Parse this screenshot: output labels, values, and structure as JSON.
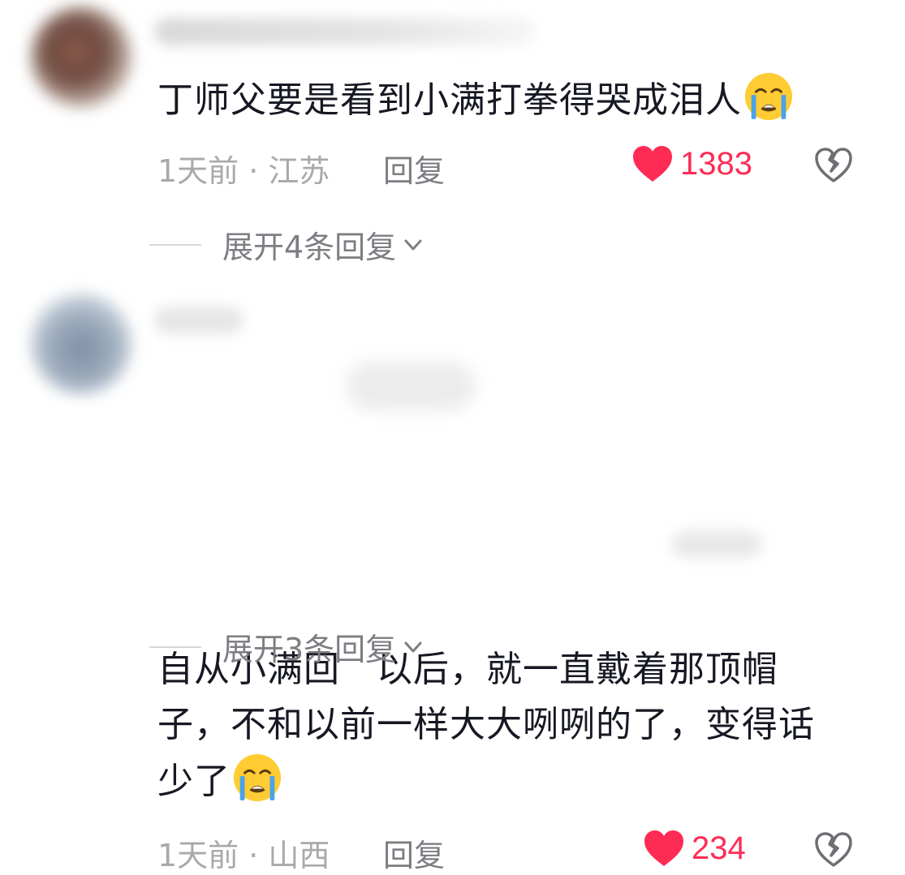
{
  "comments": [
    {
      "text": "丁师父要是看到小满打拳得哭成泪人",
      "time_location": "1天前 · 江苏",
      "reply_label": "回复",
      "likes": "1383",
      "expand_label": "展开4条回复",
      "emoji": "loudly-crying-face"
    },
    {
      "text": "自从小满回   以后，就一直戴着那顶帽\n子，不和以前一样大大咧咧的了，变得话\n少了",
      "time_location": "1天前 · 山西",
      "reply_label": "回复",
      "likes": "234",
      "expand_label": "展开3条回复",
      "emoji": "loudly-crying-face"
    }
  ],
  "colors": {
    "like_heart": "#fe2c55",
    "text_primary": "#161823",
    "text_secondary": "#a8a9ad",
    "reply": "#7d7e83"
  }
}
